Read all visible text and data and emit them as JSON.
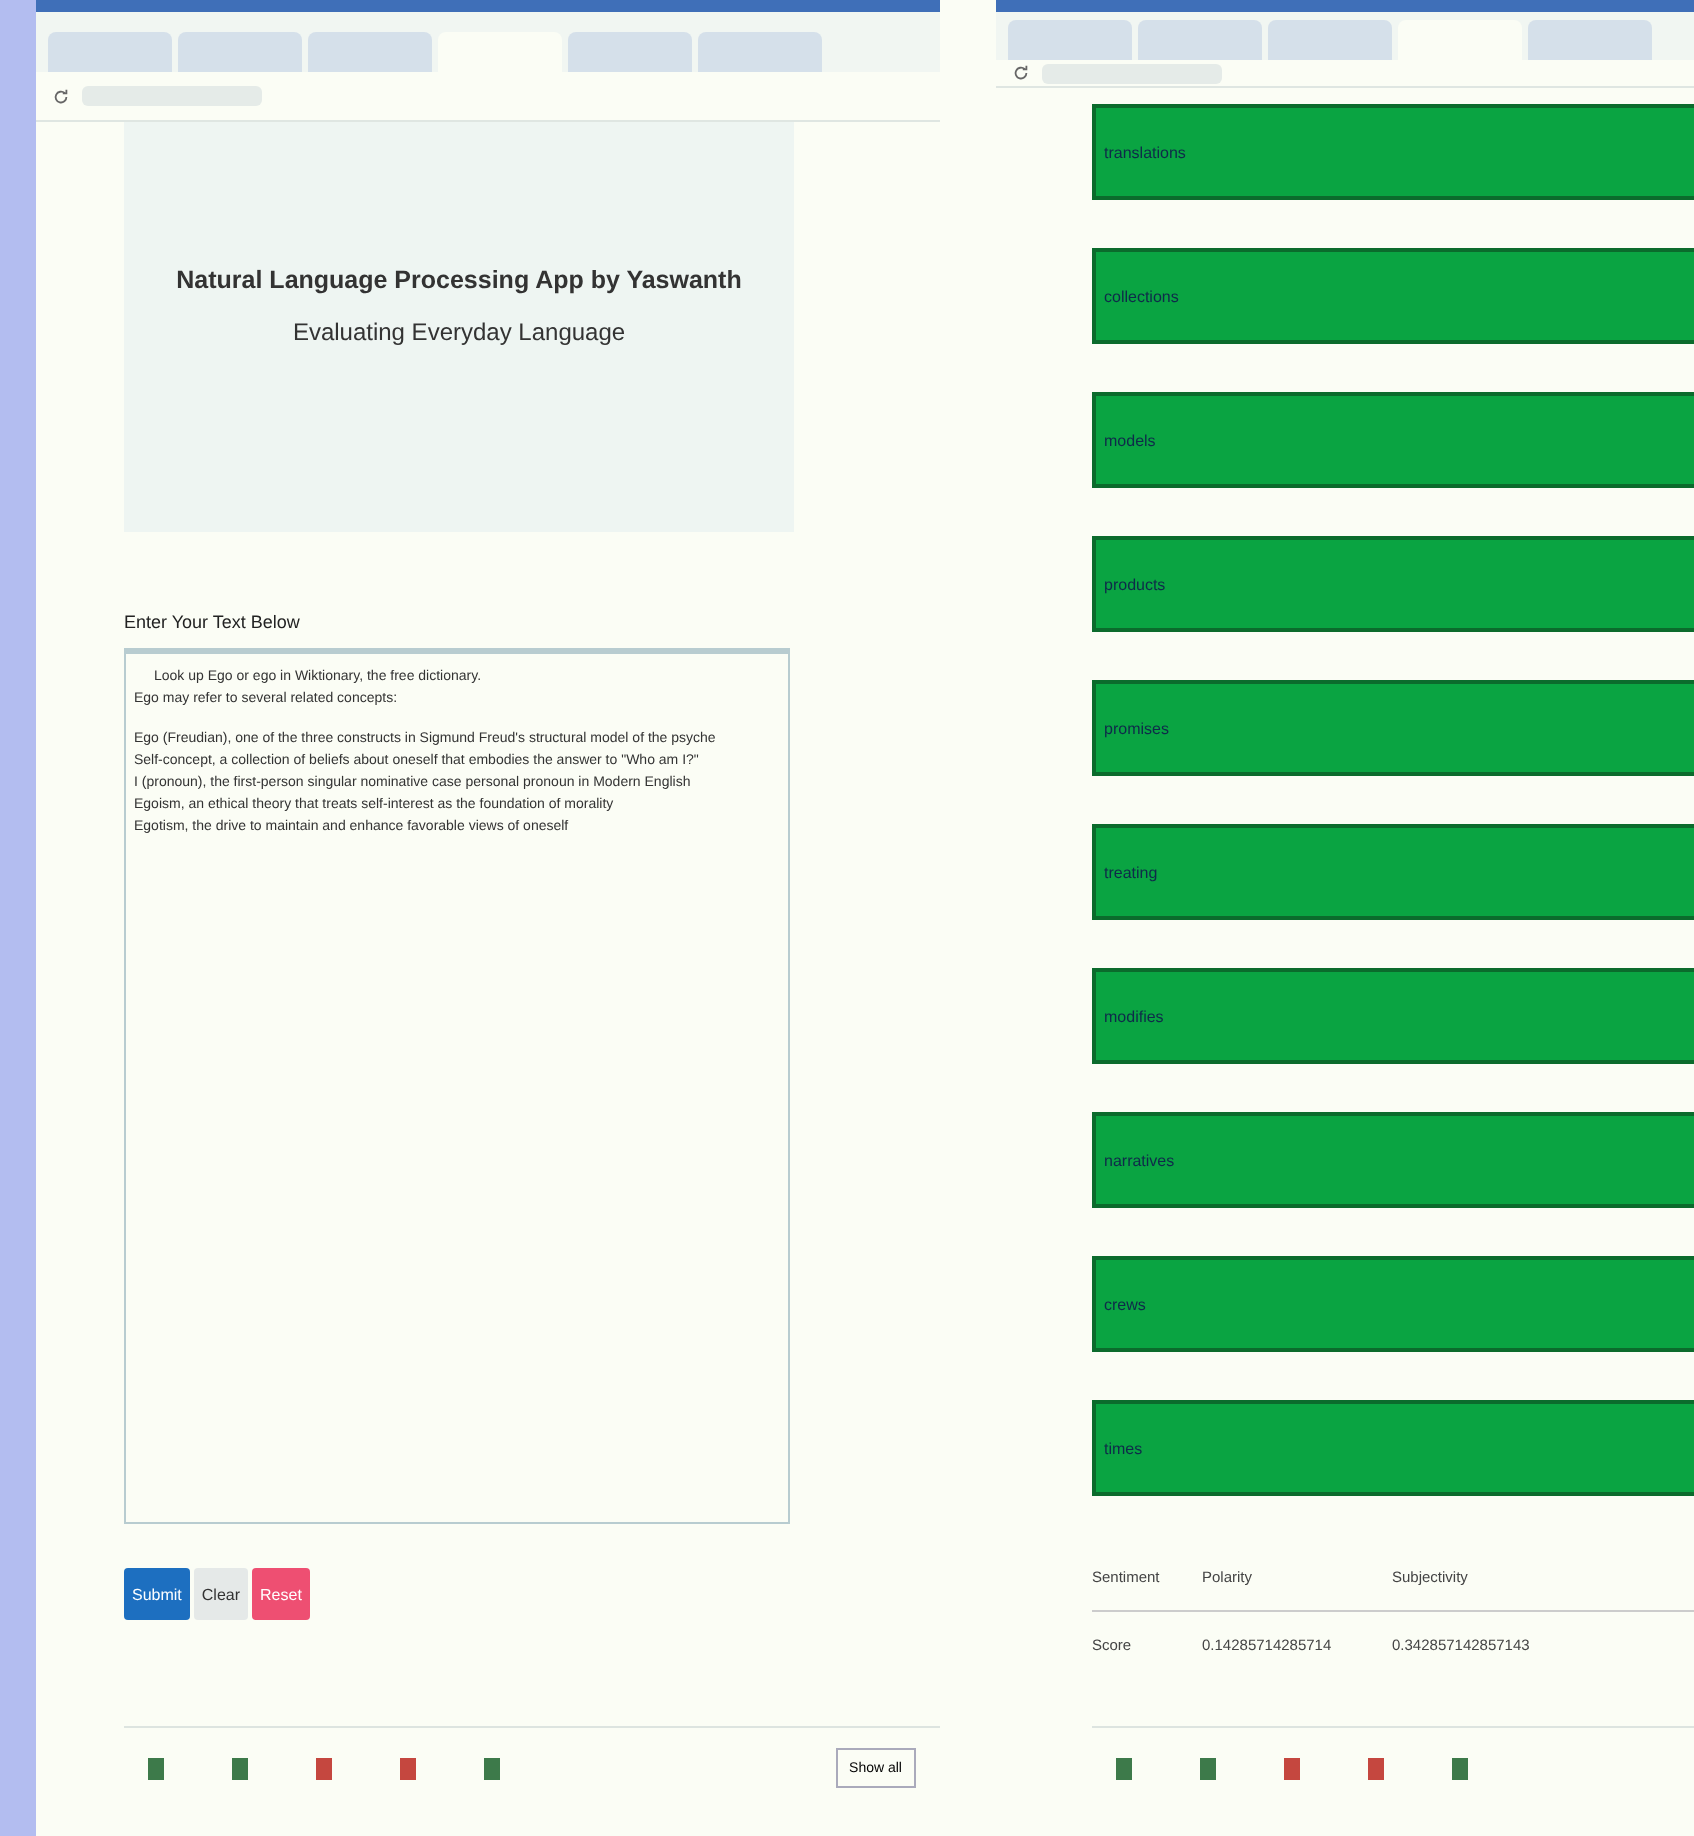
{
  "left_window": {
    "tabs": [
      {
        "selected": false
      },
      {
        "selected": false
      },
      {
        "selected": false
      },
      {
        "selected": true
      },
      {
        "selected": false
      },
      {
        "selected": false
      }
    ],
    "header": {
      "title": "Natural Language Processing App by Yaswanth",
      "subtitle": "Evaluating Everyday Language"
    },
    "input_label": "Enter Your Text Below",
    "text_paragraphs": [
      [
        "Look up Ego or ego in Wiktionary, the free dictionary.",
        "Ego may refer to several related concepts:"
      ],
      [
        "Ego (Freudian), one of the three constructs in Sigmund Freud's structural model of the psyche",
        "Self-concept, a collection of beliefs about oneself that embodies the answer to \"Who am I?\"",
        "I (pronoun), the first-person singular nominative case personal pronoun in Modern English",
        "Egoism, an ethical theory that treats self-interest as the foundation of morality",
        "Egotism, the drive to maintain and enhance favorable views of oneself"
      ]
    ],
    "buttons": [
      {
        "label": "Submit",
        "kind": "primary"
      },
      {
        "label": "Clear",
        "kind": "plain"
      },
      {
        "label": "Reset",
        "kind": "danger"
      }
    ],
    "downloads": [
      {
        "kind": "image"
      },
      {
        "kind": "image"
      },
      {
        "kind": "document"
      },
      {
        "kind": "document"
      },
      {
        "kind": "image"
      }
    ],
    "show_all": "Show all"
  },
  "right_window": {
    "tabs": [
      {
        "selected": false
      },
      {
        "selected": false
      },
      {
        "selected": false
      },
      {
        "selected": true
      },
      {
        "selected": false
      }
    ],
    "phrases": [
      "translations",
      "collections",
      "models",
      "products",
      "promises",
      "treating",
      "modifies",
      "narratives",
      "crews",
      "times"
    ],
    "table": {
      "columns": [
        "Sentiment",
        "Polarity",
        "Subjectivity"
      ],
      "rows": [
        [
          "Score",
          "0.14285714285714",
          "0.342857142857143"
        ]
      ]
    },
    "downloads": [
      {
        "kind": "image"
      },
      {
        "kind": "image"
      },
      {
        "kind": "document"
      },
      {
        "kind": "document"
      },
      {
        "kind": "image"
      }
    ]
  }
}
